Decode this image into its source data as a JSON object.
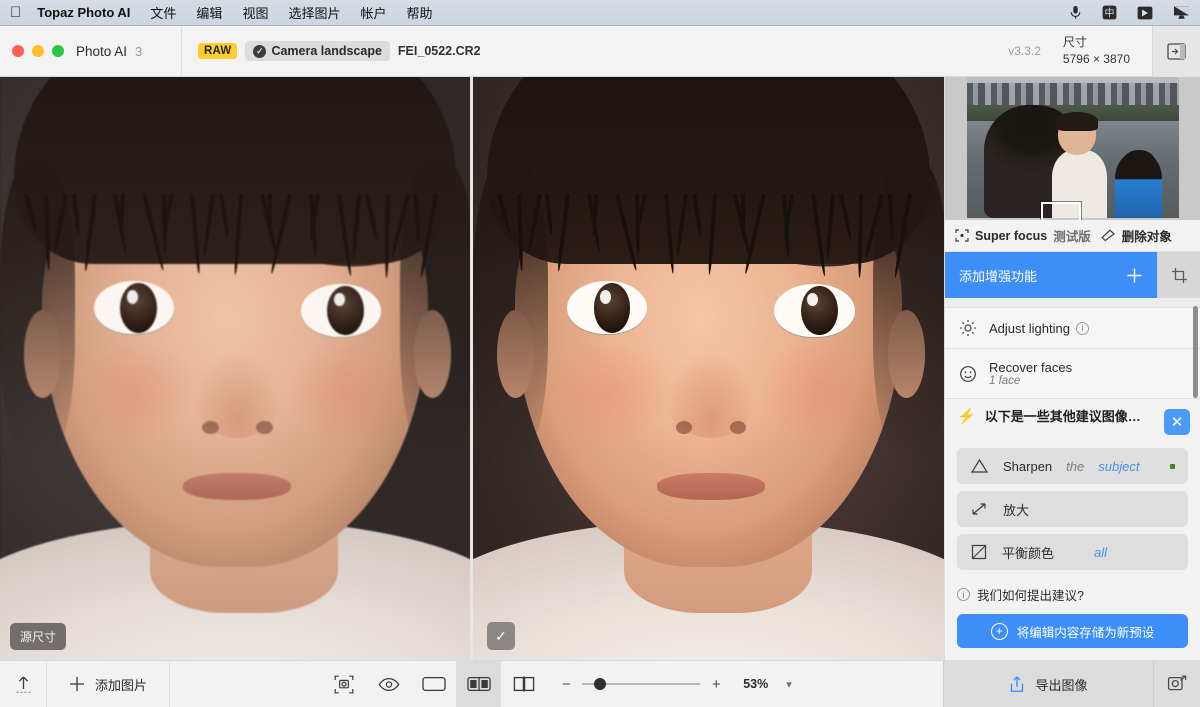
{
  "menubar": {
    "apple_icon": "apple-icon",
    "app_name": "Topaz Photo AI",
    "items": [
      "文件",
      "编辑",
      "视图",
      "选择图片",
      "帐户",
      "帮助"
    ],
    "status_icons": [
      "microphone-icon",
      "input-method-chinese-icon",
      "screen-share-icon",
      "display-icon"
    ],
    "input_method_label": "中"
  },
  "titlebar": {
    "app_label": "Photo AI",
    "app_count": "3",
    "raw_badge": "RAW",
    "preset_chip": "Camera landscape",
    "filename": "FEI_0522.CR2",
    "version": "v3.3.2",
    "dims_label": "尺寸",
    "dims_value": "5796 × 3870",
    "panel_toggle_icon": "panel-toggle-icon"
  },
  "canvas": {
    "left_badge": "源尺寸",
    "right_check_icon": "check-icon",
    "compare_mode": "split-view"
  },
  "sidebar": {
    "navigator": {
      "selection_icon": "navigator-selection-rect"
    },
    "tools": [
      {
        "icon": "super-focus-icon",
        "label": "Super focus",
        "sub": "测试版"
      },
      {
        "icon": "remove-object-icon",
        "label": "删除对象",
        "sub": ""
      }
    ],
    "add_enhancement": {
      "label": "添加增强功能",
      "plus_icon": "plus-icon",
      "color": "#3d8ef7"
    },
    "crop_icon": "crop-icon",
    "enhancements": [
      {
        "icon": "lighting-icon",
        "title": "Adjust lighting",
        "sub": "",
        "info": "i"
      },
      {
        "icon": "face-icon",
        "title": "Recover faces",
        "sub": "1 face",
        "info": ""
      }
    ],
    "suggestions": {
      "bolt_icon": "bolt-icon",
      "heading": "以下是一些其他建议图像…",
      "close_icon": "close-icon",
      "items": [
        {
          "icon": "sharpen-triangle-icon",
          "label": "Sharpen",
          "mid": "the",
          "link": "subject",
          "has_dot": true
        },
        {
          "icon": "upscale-arrows-icon",
          "label": "放大",
          "mid": "",
          "link": "",
          "has_dot": false
        },
        {
          "icon": "balance-color-icon",
          "label": "平衡颜色",
          "mid": "",
          "link": "all",
          "has_dot": false
        }
      ],
      "how_label": "我们如何提出建议?",
      "how_icon": "info-icon",
      "preset_button": "将编辑内容存储为新预设",
      "preset_icon": "plus-circle-icon"
    }
  },
  "bottombar": {
    "upload_icon": "upload-icon",
    "add_images_icon": "plus-icon",
    "add_images_label": "添加图片",
    "view_icons": [
      {
        "name": "focus-check-icon",
        "active": false
      },
      {
        "name": "eye-preview-icon",
        "active": false
      },
      {
        "name": "single-view-icon",
        "active": false
      },
      {
        "name": "split-view-icon",
        "active": true
      },
      {
        "name": "side-by-side-icon",
        "active": false
      }
    ],
    "zoom_minus": "−",
    "zoom_plus": "+",
    "zoom_value": "53%",
    "zoom_chevron_icon": "chevron-down-icon",
    "export_icon": "share-export-icon",
    "export_label": "导出图像",
    "settings_icon": "image-settings-icon"
  }
}
